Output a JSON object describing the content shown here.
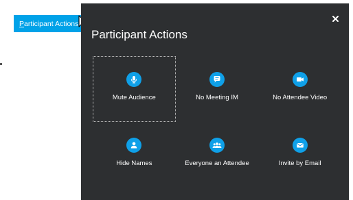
{
  "trigger": {
    "label_underlined": "P",
    "label_rest": "articipant Actions"
  },
  "dialog": {
    "title": "Participant Actions",
    "close_symbol": "✕"
  },
  "actions": [
    {
      "icon": "microphone-icon",
      "label": "Mute Audience",
      "focused": true
    },
    {
      "icon": "chat-bubble-icon",
      "label": "No Meeting IM",
      "focused": false
    },
    {
      "icon": "video-camera-icon",
      "label": "No Attendee Video",
      "focused": false
    },
    {
      "icon": "person-icon",
      "label": "Hide Names",
      "focused": false
    },
    {
      "icon": "group-icon",
      "label": "Everyone an Attendee",
      "focused": false
    },
    {
      "icon": "envelope-icon",
      "label": "Invite by Email",
      "focused": false
    }
  ],
  "colors": {
    "panel_bg": "#2d2f31",
    "accent": "#0fa0e8",
    "trigger_bg": "#00a2e8"
  }
}
